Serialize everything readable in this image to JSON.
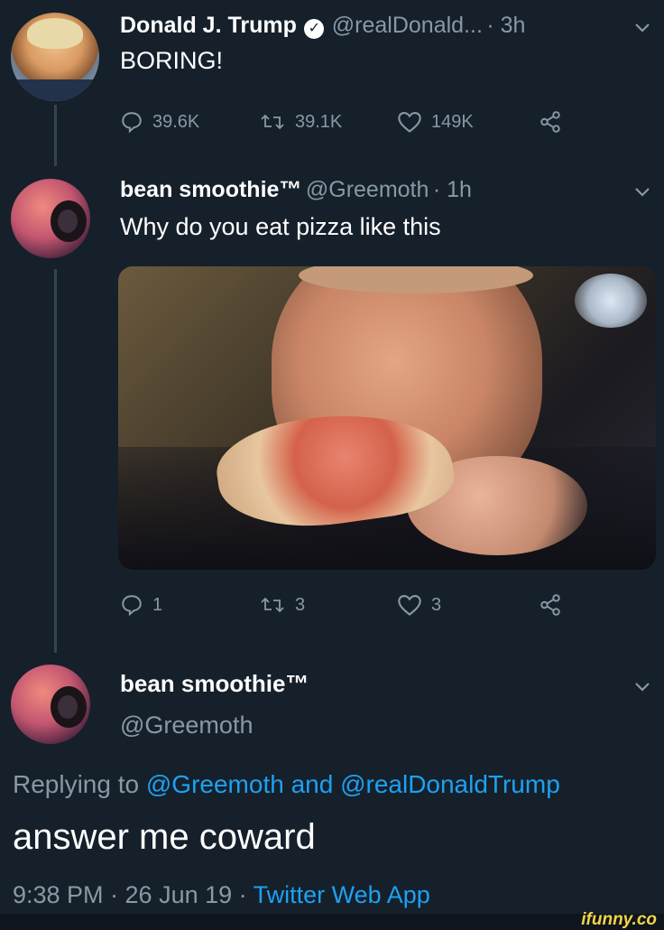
{
  "tweet1": {
    "name": "Donald J. Trump",
    "handle": "@realDonald...",
    "time": "· 3h",
    "text": "BORING!",
    "replies": "39.6K",
    "retweets": "39.1K",
    "likes": "149K"
  },
  "tweet2": {
    "name": "bean smoothie™",
    "handle": "@Greemoth",
    "time": "· 1h",
    "text": "Why do you eat pizza like this",
    "replies": "1",
    "retweets": "3",
    "likes": "3"
  },
  "focused": {
    "name": "bean smoothie™",
    "handle": "@Greemoth",
    "replying_prefix": "Replying to",
    "reply_mention_1": "@Greemoth",
    "reply_and": "and",
    "reply_mention_2": "@realDonaldTrump",
    "text": "answer me coward",
    "timestamp": "9:38 PM · 26 Jun 19 ·",
    "source": "Twitter Web App"
  },
  "watermark": "ifunny.co",
  "icons": {
    "verified": "verified-badge-icon",
    "reply": "reply-icon",
    "retweet": "retweet-icon",
    "like": "heart-icon",
    "share": "share-icon",
    "chevron": "chevron-down-icon"
  },
  "colors": {
    "background": "#15202b",
    "secondary_text": "#8899a6",
    "link": "#1da1f2"
  }
}
